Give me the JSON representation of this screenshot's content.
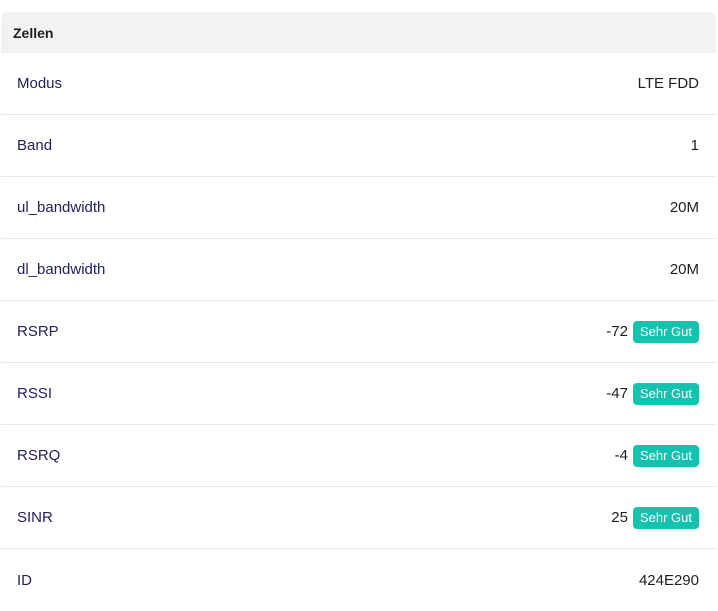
{
  "panel": {
    "title": "Zellen"
  },
  "rows": [
    {
      "label": "Modus",
      "value": "LTE FDD",
      "badge": null
    },
    {
      "label": "Band",
      "value": "1",
      "badge": null
    },
    {
      "label": "ul_bandwidth",
      "value": "20M",
      "badge": null
    },
    {
      "label": "dl_bandwidth",
      "value": "20M",
      "badge": null
    },
    {
      "label": "RSRP",
      "value": "-72",
      "badge": "Sehr Gut"
    },
    {
      "label": "RSSI",
      "value": "-47",
      "badge": "Sehr Gut"
    },
    {
      "label": "RSRQ",
      "value": "-4",
      "badge": "Sehr Gut"
    },
    {
      "label": "SINR",
      "value": "25",
      "badge": "Sehr Gut"
    },
    {
      "label": "ID",
      "value": "424E290",
      "badge": null
    }
  ],
  "colors": {
    "badge_background": "#13c3b0",
    "header_background": "#f2f2f5",
    "label_text": "#22215a"
  }
}
